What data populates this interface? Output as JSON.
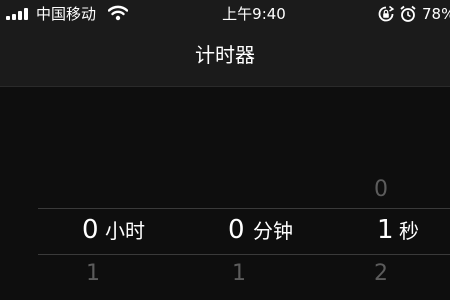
{
  "status_bar": {
    "carrier": "中国移动",
    "time": "上午9:40",
    "battery": "78%",
    "icons": [
      "signal-icon",
      "wifi-icon",
      "rotation-lock-icon",
      "alarm-icon"
    ]
  },
  "nav": {
    "title": "计时器"
  },
  "picker": {
    "hours": {
      "value": "0",
      "unit": "小时",
      "below": "1"
    },
    "minutes": {
      "value": "0",
      "unit": "分钟",
      "below": "1"
    },
    "seconds": {
      "above": "0",
      "value": "1",
      "unit": "秒",
      "below": "2"
    }
  },
  "colors": {
    "background": "#0e0e0e",
    "bar": "#1b1b1b",
    "faded_text": "#5c5c5c"
  }
}
